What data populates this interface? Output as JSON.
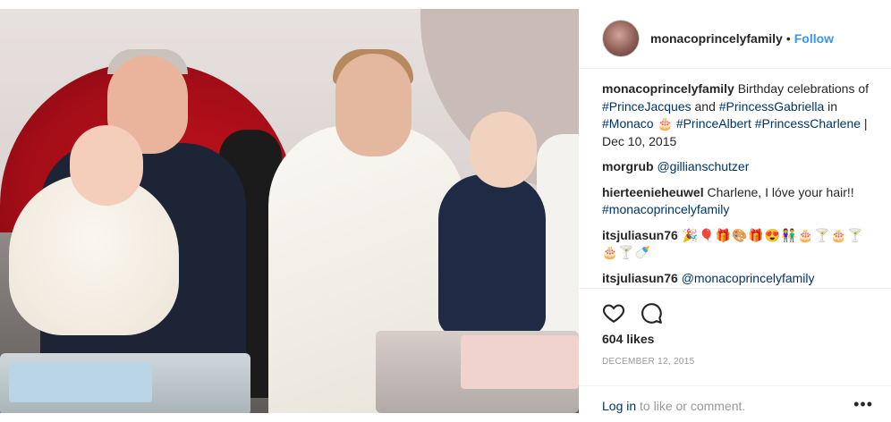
{
  "post": {
    "username": "monacoprincelyfamily",
    "separator": "•",
    "follow_label": "Follow"
  },
  "caption": {
    "username": "monacoprincelyfamily",
    "t1": " Birthday celebrations of ",
    "tag1": "#PrinceJacques",
    "t2": " and ",
    "tag2": "#PrincessGabriella",
    "t3": " in ",
    "tag3": "#Monaco",
    "t4": " 🎂 ",
    "tag4": "#PrinceAlbert",
    "t5": " ",
    "tag5": "#PrincessCharlene",
    "t6": " | Dec 10, 2015"
  },
  "comments": [
    {
      "username": "morgrub",
      "mention": "@gillianschutzer"
    },
    {
      "username": "hierteenieheuwel",
      "text": " Charlene, I lóve your hair!! ",
      "tag": "#monacoprincelyfamily"
    },
    {
      "username": "itsjuliasun76",
      "text": " 🎉🎈🎁🎨🎁😍👫🎂🍸🎂🍸🎂🍸🍼"
    },
    {
      "username": "itsjuliasun76",
      "mention": "@monacoprincelyfamily"
    }
  ],
  "actions": {
    "heart_icon": "heart-icon",
    "comment_icon": "comment-icon",
    "likes": "604 likes",
    "date": "DECEMBER 12, 2015"
  },
  "footer": {
    "login_link": "Log in",
    "login_rest": " to like or comment.",
    "more": "•••"
  }
}
